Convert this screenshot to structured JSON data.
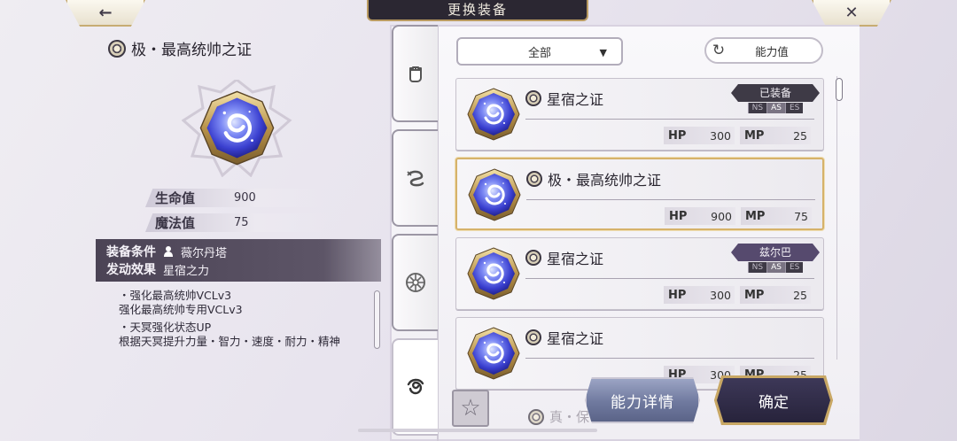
{
  "header": {
    "title": "更换装备",
    "back_icon": "←",
    "close_icon": "✕"
  },
  "detail": {
    "name": "极・最高统帅之证",
    "stats": [
      {
        "label": "生命值",
        "value": "900"
      },
      {
        "label": "魔法值",
        "value": "75"
      }
    ],
    "condition_label": "装备条件",
    "condition_value": "薇尔丹塔",
    "effect_label": "发动效果",
    "effect_value": "星宿之力",
    "effects": [
      {
        "title": "・强化最高统帅VCLv3",
        "desc": "强化最高统帅专用VCLv3"
      },
      {
        "title": "・天冥强化状态UP",
        "desc": "根据天冥提升力量・智力・速度・耐力・精神"
      }
    ]
  },
  "filter": {
    "selected": "全部",
    "sort_label": "能力值"
  },
  "list": {
    "items": [
      {
        "name": "星宿之证",
        "hp": "300",
        "mp": "25",
        "badge": "已装备",
        "badge_style": "dark",
        "positions": [
          "NS",
          "AS",
          "ES"
        ],
        "active_pos": "AS",
        "selected": false
      },
      {
        "name": "极・最高统帅之证",
        "hp": "900",
        "mp": "75",
        "badge": "",
        "selected": true
      },
      {
        "name": "星宿之证",
        "hp": "300",
        "mp": "25",
        "badge": "兹尔巴",
        "badge_style": "purple",
        "positions": [
          "NS",
          "AS",
          "ES"
        ],
        "active_pos": "AS",
        "selected": false
      },
      {
        "name": "星宿之证",
        "hp": "300",
        "mp": "25",
        "badge": "",
        "selected": false
      }
    ],
    "partial_item": "真・保"
  },
  "stat_labels": {
    "hp": "HP",
    "mp": "MP"
  },
  "buttons": {
    "detail": "能力详情",
    "confirm": "确定"
  },
  "colors": {
    "accent_gold": "#c8a764",
    "panel_dark": "#4b4355",
    "gem_blue": "#3b46d6"
  },
  "icons": {
    "back": "back-arrow-icon",
    "close": "close-icon",
    "sort": "refresh-icon",
    "favorite": "star-icon"
  }
}
